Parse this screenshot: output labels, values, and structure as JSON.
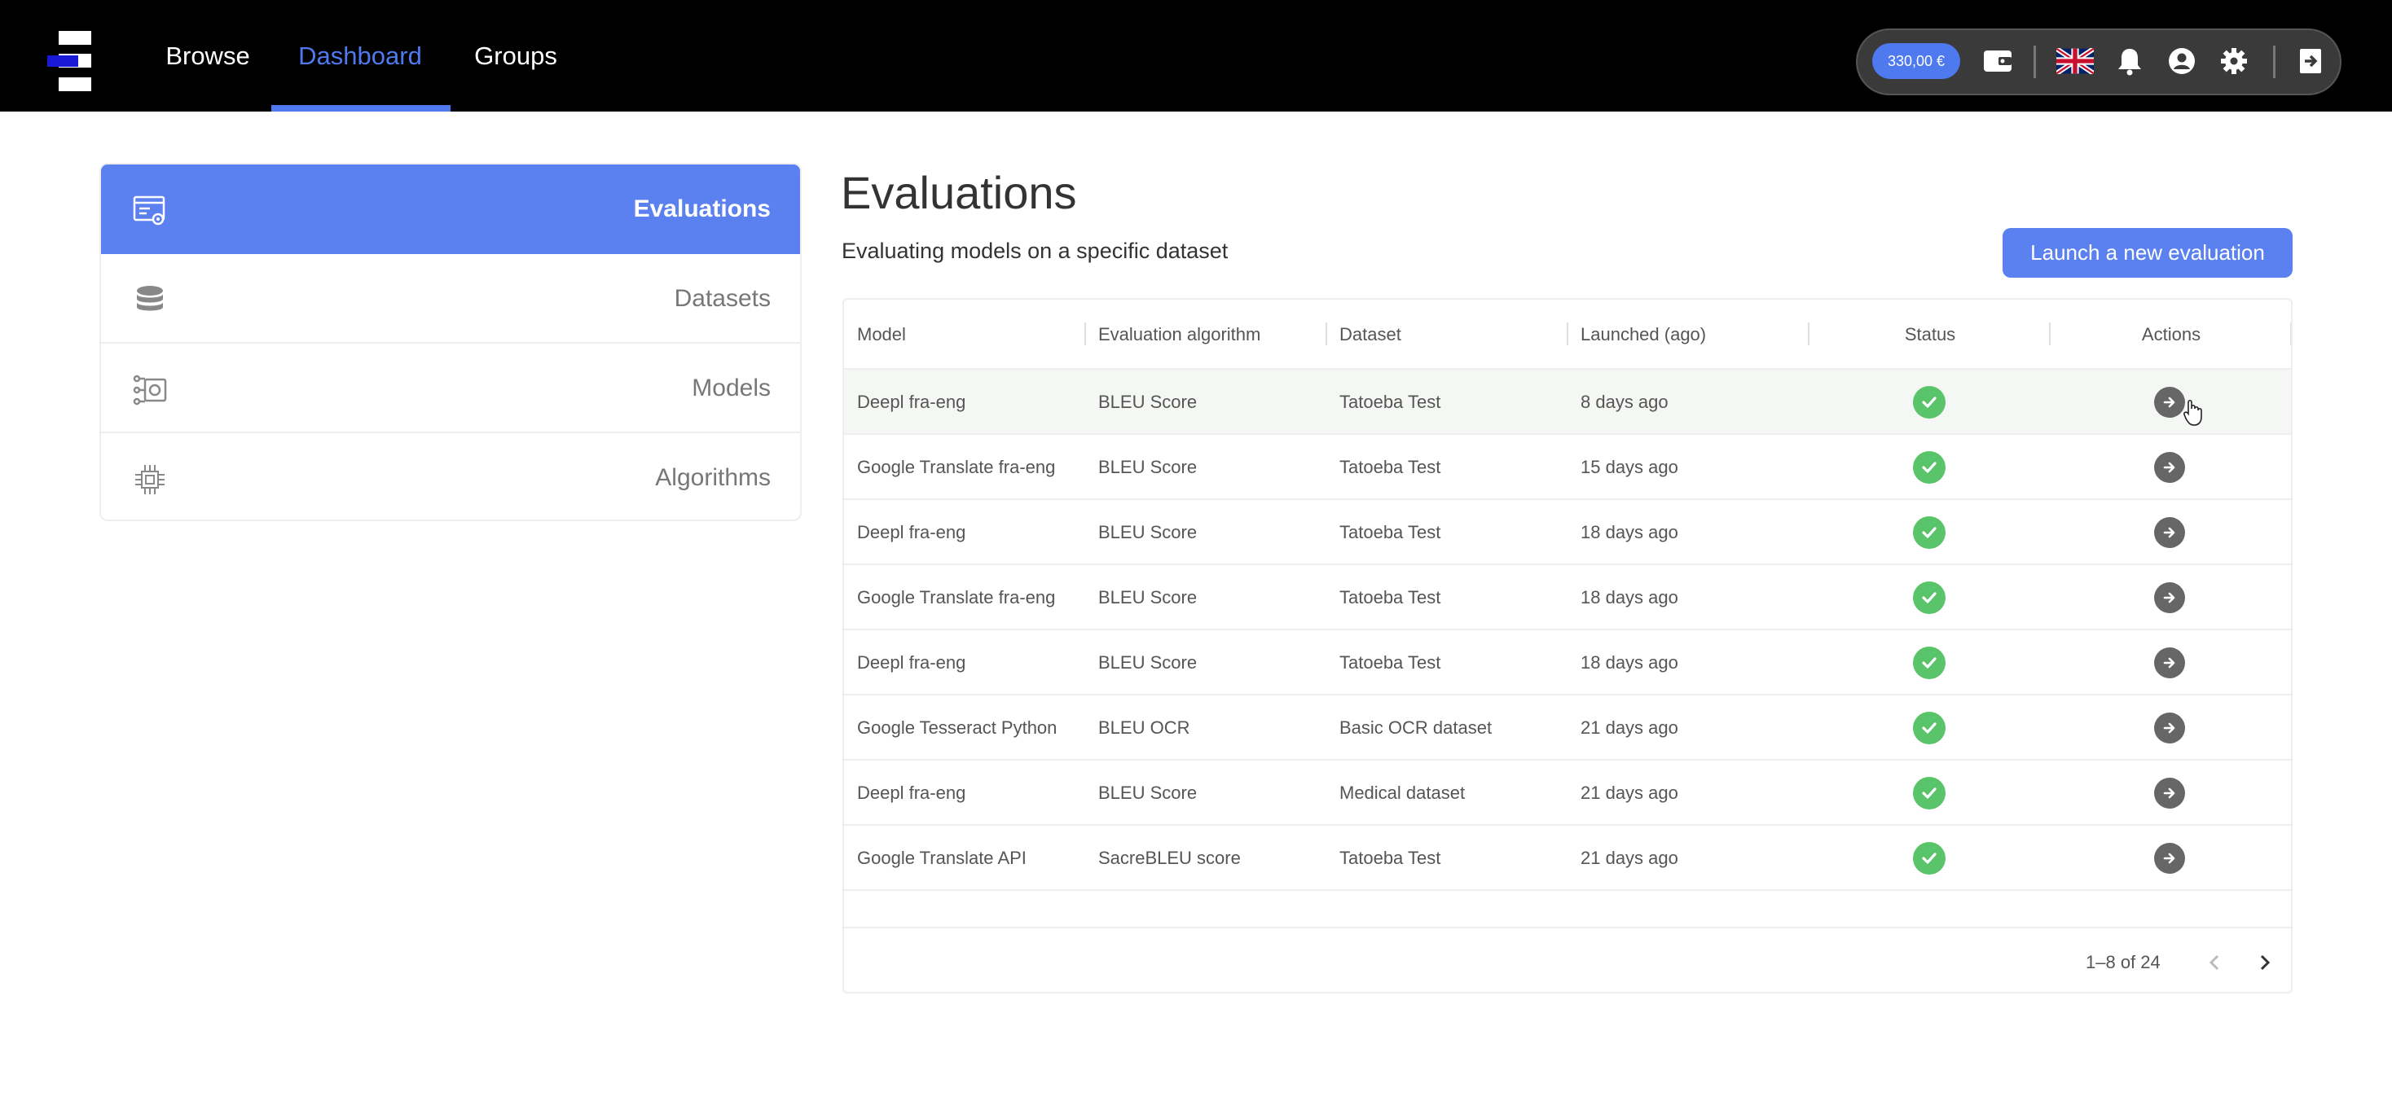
{
  "topbar": {
    "nav": {
      "browse": "Browse",
      "dashboard": "Dashboard",
      "groups": "Groups"
    },
    "balance": "330,00 €",
    "icons": [
      "wallet-icon",
      "uk-flag-icon",
      "bell-icon",
      "user-icon",
      "gear-icon",
      "logout-icon"
    ]
  },
  "sidebar": {
    "items": [
      {
        "label": "Evaluations",
        "icon": "evaluation-icon",
        "active": true
      },
      {
        "label": "Datasets",
        "icon": "database-icon",
        "active": false
      },
      {
        "label": "Models",
        "icon": "model-icon",
        "active": false
      },
      {
        "label": "Algorithms",
        "icon": "chip-icon",
        "active": false
      }
    ]
  },
  "main": {
    "title": "Evaluations",
    "subtitle": "Evaluating models on a specific dataset",
    "launch_button": "Launch a new evaluation"
  },
  "table": {
    "headers": {
      "model": "Model",
      "algorithm": "Evaluation algorithm",
      "dataset": "Dataset",
      "launched": "Launched (ago)",
      "status": "Status",
      "actions": "Actions"
    },
    "rows": [
      {
        "model": "Deepl fra-eng",
        "algorithm": "BLEU Score",
        "dataset": "Tatoeba Test",
        "launched": "8 days ago",
        "status": "success"
      },
      {
        "model": "Google Translate fra-eng",
        "algorithm": "BLEU Score",
        "dataset": "Tatoeba Test",
        "launched": "15 days ago",
        "status": "success"
      },
      {
        "model": "Deepl fra-eng",
        "algorithm": "BLEU Score",
        "dataset": "Tatoeba Test",
        "launched": "18 days ago",
        "status": "success"
      },
      {
        "model": "Google Translate fra-eng",
        "algorithm": "BLEU Score",
        "dataset": "Tatoeba Test",
        "launched": "18 days ago",
        "status": "success"
      },
      {
        "model": "Deepl fra-eng",
        "algorithm": "BLEU Score",
        "dataset": "Tatoeba Test",
        "launched": "18 days ago",
        "status": "success"
      },
      {
        "model": "Google Tesseract Python",
        "algorithm": "BLEU OCR",
        "dataset": "Basic OCR dataset",
        "launched": "21 days ago",
        "status": "success"
      },
      {
        "model": "Deepl fra-eng",
        "algorithm": "BLEU Score",
        "dataset": "Medical dataset",
        "launched": "21 days ago",
        "status": "success"
      },
      {
        "model": "Google Translate API",
        "algorithm": "SacreBLEU score",
        "dataset": "Tatoeba Test",
        "launched": "21 days ago",
        "status": "success"
      }
    ],
    "pagination": "1–8 of 24"
  },
  "colors": {
    "accent": "#5b80f0",
    "nav_active": "#4f79ee",
    "success": "#5ac46b",
    "action": "#666666"
  }
}
